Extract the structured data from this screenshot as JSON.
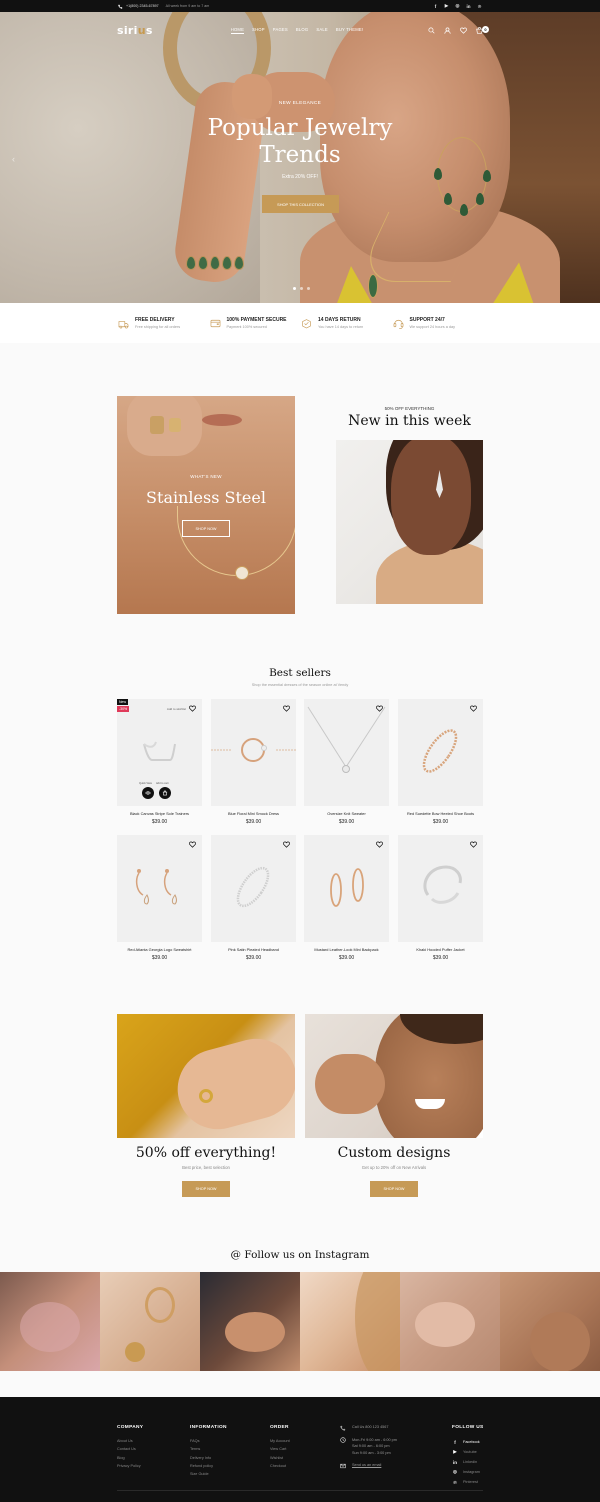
{
  "topbar": {
    "phone": "+1(800) 2345-67897",
    "note": "All week from 9 am to 7 am",
    "social_icons": [
      "facebook-icon",
      "youtube-icon",
      "instagram-icon",
      "linkedin-icon",
      "pinterest-icon"
    ]
  },
  "nav": {
    "logo_pre": "siri",
    "logo_o": "u",
    "logo_post": "s",
    "menu": [
      "HOME",
      "SHOP",
      "PAGES",
      "BLOG",
      "SALE",
      "BUY THEME!"
    ],
    "cart_count": "0"
  },
  "hero": {
    "tag": "NEW ELEGANCE",
    "title_line1": "Popular Jewelry",
    "title_line2": "Trends",
    "subtitle": "Extra 20% OFF!",
    "button": "SHOP THIS COLLECTION",
    "slides": 3,
    "active_slide": 0
  },
  "features": [
    {
      "title": "FREE DELIVERY",
      "desc": "Free shipping for all orders",
      "icon": "delivery-icon"
    },
    {
      "title": "100% PAYMENT SECURE",
      "desc": "Payment 100% secured",
      "icon": "payment-icon"
    },
    {
      "title": "14 DAYS RETURN",
      "desc": "You have 14 days to return",
      "icon": "return-icon"
    },
    {
      "title": "SUPPORT 24/7",
      "desc": "We support 24 hours a day",
      "icon": "support-icon"
    }
  ],
  "promo_left": {
    "label": "WHAT'S NEW",
    "title": "Stainless Steel",
    "button": "SHOP NOW"
  },
  "promo_right": {
    "label": "50% OFF EVERYTHING",
    "title": "New in this week"
  },
  "best_sellers": {
    "title": "Best sellers",
    "subtitle": "Shop the essential dresses of the season online at Vendy",
    "badge_new": "New",
    "badge_sale": "-30%",
    "wishlist_label": "Add to wishlist",
    "quick_view": "Quick View",
    "add_to_cart": "Add to cart",
    "products": [
      {
        "name": "Black Canvas Stripe Sole Trainers",
        "price": "$39.00"
      },
      {
        "name": "Blue Floral Mini Smock Dress",
        "price": "$39.00"
      },
      {
        "name": "Oversize Knit Sweater",
        "price": "$39.00"
      },
      {
        "name": "Red Suedette Bow Heeled Shoe Boots",
        "price": "$39.00"
      },
      {
        "name": "Red Atlanta Georgia Logo Sweatshirt",
        "price": "$39.00"
      },
      {
        "name": "Pink Satin Pleated Headband",
        "price": "$39.00"
      },
      {
        "name": "Mustard Leather-Look Mini Backpack",
        "price": "$39.00"
      },
      {
        "name": "Khaki Hooded Puffer Jacket",
        "price": "$39.00"
      }
    ]
  },
  "bottom_promos": [
    {
      "title": "50% off everything!",
      "subtitle": "Best price, best selection",
      "button": "SHOP NOW"
    },
    {
      "title": "Custom designs",
      "subtitle": "Get up to 20% off on New Arrivals",
      "button": "SHOP NOW"
    }
  ],
  "instagram": {
    "title": "@ Follow us on Instagram"
  },
  "footer": {
    "company": {
      "title": "COMPANY",
      "links": [
        "About Us",
        "Contact Us",
        "Blog",
        "Privacy Policy"
      ]
    },
    "information": {
      "title": "INFORMATION",
      "links": [
        "FAQs",
        "Terms",
        "Delivery Info",
        "Refund policy",
        "Size Guide"
      ]
    },
    "order": {
      "title": "ORDER",
      "links": [
        "My Account",
        "View Cart",
        "Wishlist",
        "Checkout"
      ]
    },
    "contact": {
      "phone": "Call Us 800 123 4567",
      "hours_1": "Mon-Fri 9:00 am - 6:00 pm",
      "hours_2": "Sat 9:00 am - 6:00 pm",
      "hours_3": "Sun 9:00 am - 3:00 pm",
      "email": "Send us an email"
    },
    "follow": {
      "title": "FOLLOW US",
      "links": [
        "Facebook",
        "Youtube",
        "Linkedin",
        "Instagram",
        "Pinterest"
      ]
    }
  },
  "colors": {
    "accent": "#c69a56",
    "dark": "#111111",
    "sale": "#e03a5a"
  }
}
